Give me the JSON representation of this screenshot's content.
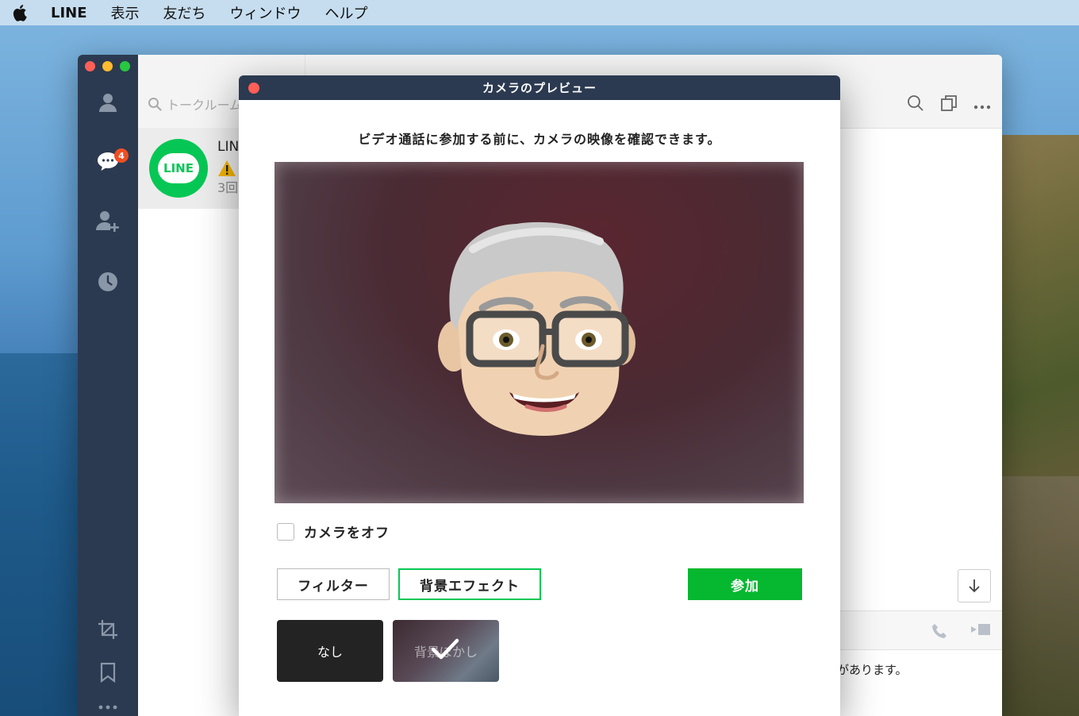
{
  "menubar": {
    "app_name": "LINE",
    "items": [
      "表示",
      "友だち",
      "ウィンドウ",
      "ヘルプ"
    ]
  },
  "sidebar": {
    "unread_badge": "4"
  },
  "chat_list": {
    "search_placeholder": "トークルーム",
    "item": {
      "name": "LIN",
      "preview_count": "3回",
      "logo_text": "LINE"
    }
  },
  "conversation": {
    "notice_text": "があります。"
  },
  "modal": {
    "title": "カメラのプレビュー",
    "message": "ビデオ通話に参加する前に、カメラの映像を確認できます。",
    "camera_off_label": "カメラをオフ",
    "camera_off_checked": false,
    "filter_button": "フィルター",
    "background_button": "背景エフェクト",
    "join_button": "参加",
    "effects": [
      {
        "label": "なし",
        "selected": false
      },
      {
        "label": "背景ぼかし",
        "selected": true
      }
    ]
  },
  "colors": {
    "line_green": "#06c755",
    "join_green": "#06b730",
    "sidebar_navy": "#2b3a50",
    "badge_red": "#f04e23"
  }
}
